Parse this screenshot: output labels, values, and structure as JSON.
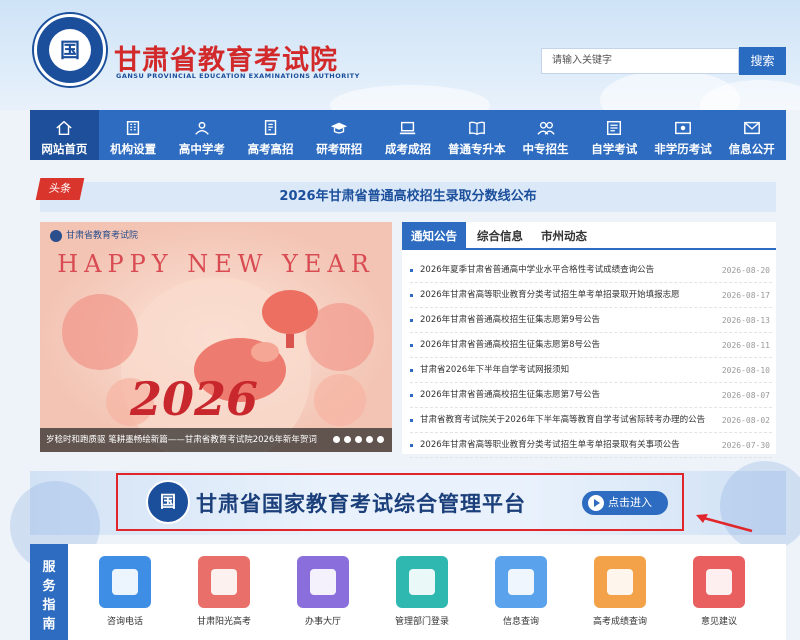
{
  "header": {
    "title": "甘肃省教育考试院",
    "subtitle": "GANSU PROVINCIAL EDUCATION EXAMINATIONS AUTHORITY",
    "search_placeholder": "请输入关键字",
    "search_button": "搜索"
  },
  "nav": {
    "items": [
      {
        "label": "网站首页",
        "icon": "home-icon"
      },
      {
        "label": "机构设置",
        "icon": "building-icon"
      },
      {
        "label": "高中学考",
        "icon": "student-icon"
      },
      {
        "label": "高考高招",
        "icon": "exam-paper-icon"
      },
      {
        "label": "研考研招",
        "icon": "graduation-cap-icon"
      },
      {
        "label": "成考成招",
        "icon": "laptop-pen-icon"
      },
      {
        "label": "普通专升本",
        "icon": "book-icon"
      },
      {
        "label": "中专招生",
        "icon": "people-icon"
      },
      {
        "label": "自学考试",
        "icon": "self-study-icon"
      },
      {
        "label": "非学历考试",
        "icon": "certificate-icon"
      },
      {
        "label": "信息公开",
        "icon": "mail-icon"
      }
    ]
  },
  "headline": {
    "tag": "头条",
    "text": "2026年甘肃省普通高校招生录取分数线公布"
  },
  "carousel": {
    "brand": "甘肃省教育考试院",
    "greeting": "HAPPY NEW YEAR",
    "year_art": "2026",
    "caption": "岁稔时和跑质驱 笔耕墨畅绘新篇——甘肃省教育考试院2026年新年贺词",
    "slide_count": 5
  },
  "notices": {
    "tabs": [
      "通知公告",
      "综合信息",
      "市州动态"
    ],
    "items": [
      {
        "title": "2026年夏季甘肃省普通高中学业水平合格性考试成绩查询公告",
        "date": "2026-08-20"
      },
      {
        "title": "2026年甘肃省高等职业教育分类考试招生单考单招录取开始填报志愿",
        "date": "2026-08-17"
      },
      {
        "title": "2026年甘肃省普通高校招生征集志愿第9号公告",
        "date": "2026-08-13"
      },
      {
        "title": "2026年甘肃省普通高校招生征集志愿第8号公告",
        "date": "2026-08-11"
      },
      {
        "title": "甘肃省2026年下半年自学考试网报须知",
        "date": "2026-08-10"
      },
      {
        "title": "2026年甘肃省普通高校招生征集志愿第7号公告",
        "date": "2026-08-07"
      },
      {
        "title": "甘肃省教育考试院关于2026年下半年高等教育自学考试省际转考办理的公告",
        "date": "2026-08-02"
      },
      {
        "title": "2026年甘肃省高等职业教育分类考试招生单考单招录取有关事项公告",
        "date": "2026-07-30"
      }
    ]
  },
  "platform": {
    "title": "甘肃省国家教育考试综合管理平台",
    "button": "点击进入"
  },
  "service": {
    "label": [
      "服",
      "务",
      "指",
      "南"
    ],
    "items": [
      {
        "label": "咨询电话",
        "icon": "phone-icon",
        "color": "#3f8ee6"
      },
      {
        "label": "甘肃阳光高考",
        "icon": "sunshine-exam-icon",
        "color": "#e9706a"
      },
      {
        "label": "办事大厅",
        "icon": "service-hall-icon",
        "color": "#8a6fdc"
      },
      {
        "label": "管理部门登录",
        "icon": "login-icon",
        "color": "#2fb8b0"
      },
      {
        "label": "信息查询",
        "icon": "document-search-icon",
        "color": "#5aa3ec"
      },
      {
        "label": "高考成绩查询",
        "icon": "score-search-icon",
        "color": "#f3a24a"
      },
      {
        "label": "意见建议",
        "icon": "feedback-icon",
        "color": "#e95f5f"
      }
    ]
  }
}
